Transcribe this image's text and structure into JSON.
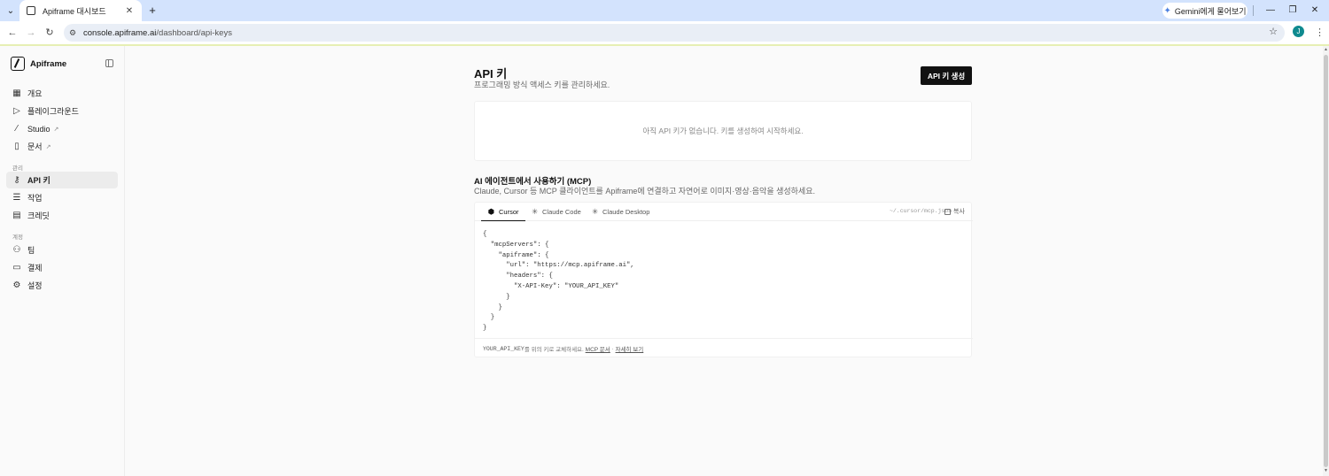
{
  "browser": {
    "tab_title": "Apiframe 대시보드",
    "url_host": "console.apiframe.ai",
    "url_path": "/dashboard/api-keys",
    "gemini_label": "Gemini에게 물어보기",
    "profile_initial": "J"
  },
  "sidebar": {
    "brand": "Apiframe",
    "items": [
      {
        "label": "개요",
        "icon": "grid-icon"
      },
      {
        "label": "플레이그라운드",
        "icon": "play-icon"
      },
      {
        "label": "Studio",
        "icon": "wand-icon",
        "external": true
      },
      {
        "label": "문서",
        "icon": "book-icon",
        "external": true
      }
    ],
    "section_manage": "관리",
    "manage_items": [
      {
        "label": "API 키",
        "icon": "key-icon",
        "active": true
      },
      {
        "label": "작업",
        "icon": "list-icon"
      },
      {
        "label": "크레딧",
        "icon": "receipt-icon"
      }
    ],
    "section_account": "계정",
    "account_items": [
      {
        "label": "팀",
        "icon": "users-icon"
      },
      {
        "label": "결제",
        "icon": "credit-card-icon"
      },
      {
        "label": "설정",
        "icon": "gear-icon"
      }
    ]
  },
  "main": {
    "title": "API 키",
    "subtitle": "프로그래밍 방식 액세스 키를 관리하세요.",
    "create_button": "API 키 생성",
    "empty_state": "아직 API 키가 없습니다. 키를 생성하여 시작하세요.",
    "mcp": {
      "title": "AI 에이전트에서 사용하기 (MCP)",
      "subtitle": "Claude, Cursor 등 MCP 클라이언트를 Apiframe에 연결하고 자연어로 이미지·영상·음악을 생성하세요.",
      "tabs": [
        "Cursor",
        "Claude Code",
        "Claude Desktop"
      ],
      "config_path": "~/.cursor/mcp.json",
      "copy_label": "복사",
      "code": "{\n  \"mcpServers\": {\n    \"apiframe\": {\n      \"url\": \"https://mcp.apiframe.ai\",\n      \"headers\": {\n        \"X-API-Key\": \"YOUR_API_KEY\"\n      }\n    }\n  }\n}",
      "footer_key": "YOUR_API_KEY",
      "footer_text": "를 위의 키로 교체하세요.",
      "footer_link1": "MCP 문서",
      "footer_sep": "·",
      "footer_link2": "자세히 보기"
    }
  }
}
